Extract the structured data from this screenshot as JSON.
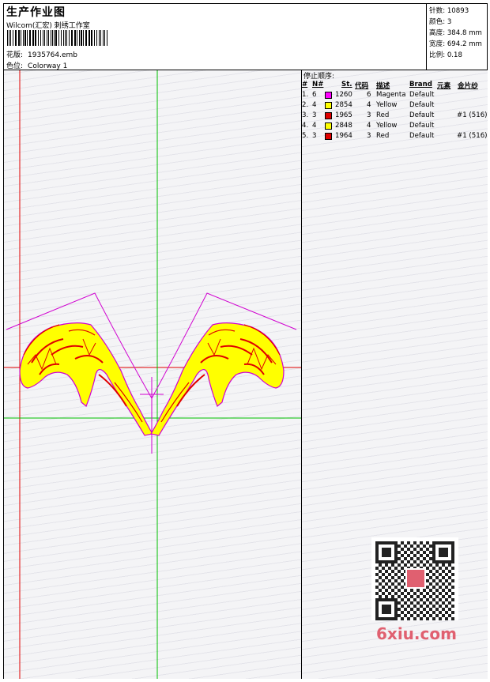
{
  "header": {
    "title": "生产作业图",
    "subtitle": "Wilcom(汇宏) 刺绣工作室",
    "design_label": "花版:",
    "design_value": "1935764.emb",
    "colorway_label": "色位:",
    "colorway_value": "Colorway 1"
  },
  "stats": {
    "stitches_label": "针数:",
    "stitches_value": "10893",
    "colors_label": "颜色:",
    "colors_value": "3",
    "height_label": "高度:",
    "height_value": "384.8 mm",
    "width_label": "宽度:",
    "width_value": "694.2 mm",
    "scale_label": "比例:",
    "scale_value": "0.18"
  },
  "stop_sequence": {
    "title": "停止顺序:",
    "headers": {
      "num": "#",
      "n": "N#",
      "st": "St.",
      "code": "代码",
      "desc": "描述",
      "brand": "Brand",
      "element": "元素",
      "sequin": "金片纱"
    },
    "rows": [
      {
        "num": "1.",
        "n": "6",
        "color": "#ff00ff",
        "st": "1260",
        "code": "6",
        "desc": "Magenta",
        "brand": "Default",
        "sequin": ""
      },
      {
        "num": "2.",
        "n": "4",
        "color": "#ffff00",
        "st": "2854",
        "code": "4",
        "desc": "Yellow",
        "brand": "Default",
        "sequin": ""
      },
      {
        "num": "3.",
        "n": "3",
        "color": "#e00000",
        "st": "1965",
        "code": "3",
        "desc": "Red",
        "brand": "Default",
        "sequin": "#1 (516)"
      },
      {
        "num": "4.",
        "n": "4",
        "color": "#ffff00",
        "st": "2848",
        "code": "4",
        "desc": "Yellow",
        "brand": "Default",
        "sequin": ""
      },
      {
        "num": "5.",
        "n": "3",
        "color": "#e00000",
        "st": "1964",
        "code": "3",
        "desc": "Red",
        "brand": "Default",
        "sequin": "#1 (516)"
      }
    ]
  },
  "watermark": {
    "text": "6xiu.com"
  },
  "colors": {
    "guide_red": "#e00000",
    "guide_green": "#00c000",
    "outline_magenta": "#d000d0",
    "fill_yellow": "#ffff00"
  }
}
